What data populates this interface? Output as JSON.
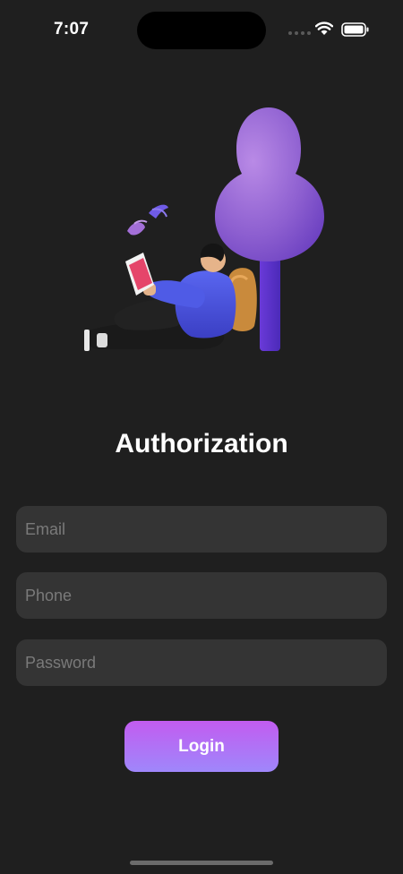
{
  "status_bar": {
    "time": "7:07",
    "icons": [
      "signal-icon",
      "wifi-icon",
      "battery-icon"
    ]
  },
  "illustration": {
    "subject": "person-reading-under-tree-illustration"
  },
  "header": {
    "title": "Authorization"
  },
  "form": {
    "email": {
      "placeholder": "Email",
      "value": ""
    },
    "phone": {
      "placeholder": "Phone",
      "value": ""
    },
    "password": {
      "placeholder": "Password",
      "value": ""
    },
    "login_label": "Login"
  },
  "colors": {
    "background": "#1f1f1f",
    "field": "#343434",
    "button_gradient_top": "#c25cf0",
    "button_gradient_bottom": "#9f87fb",
    "tree": "#8d5fd0"
  }
}
